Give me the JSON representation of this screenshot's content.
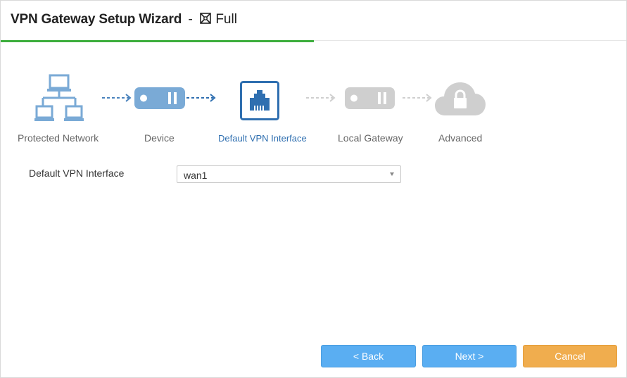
{
  "header": {
    "title": "VPN Gateway Setup Wizard",
    "separator": "-",
    "mode": "Full",
    "mode_icon": "vpn-full-icon"
  },
  "wizard": {
    "progress_fraction": 0.5,
    "steps": [
      {
        "label": "Protected Network",
        "icon": "network-icon",
        "state": "done"
      },
      {
        "label": "Device",
        "icon": "device-icon",
        "state": "done"
      },
      {
        "label": "Default VPN Interface",
        "icon": "ethernet-port-icon",
        "state": "active"
      },
      {
        "label": "Local Gateway",
        "icon": "gateway-device-icon",
        "state": "pending"
      },
      {
        "label": "Advanced",
        "icon": "cloud-lock-icon",
        "state": "pending"
      }
    ]
  },
  "form": {
    "interface_label": "Default VPN Interface",
    "interface_value": "wan1"
  },
  "buttons": {
    "back": "< Back",
    "next": "Next >",
    "cancel": "Cancel"
  },
  "colors": {
    "progress": "#3dae3d",
    "active_step": "#2f6fb0",
    "done_icon": "#7aaad6",
    "pending_icon": "#cfcfcf",
    "primary_button": "#5aaef2",
    "cancel_button": "#f0ad4e"
  }
}
